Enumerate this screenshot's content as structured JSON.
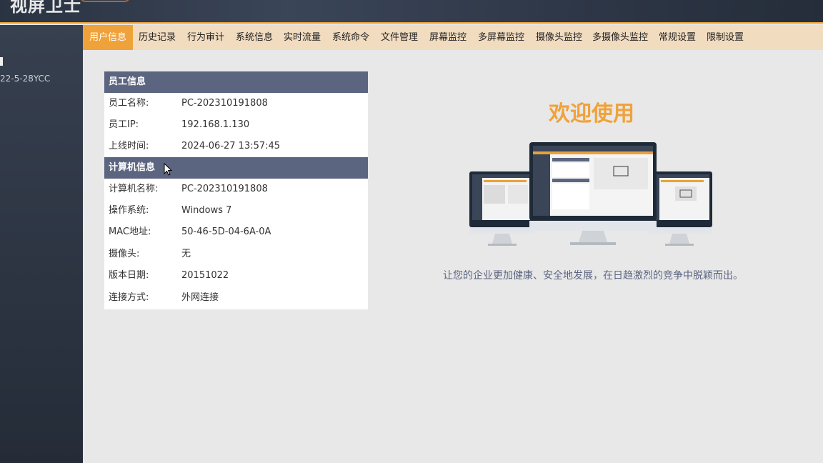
{
  "header": {
    "title": "视屏卫士"
  },
  "sidebar": {
    "version": "22-5-28YCC"
  },
  "nav": {
    "tabs": [
      {
        "label": "用户信息",
        "active": true
      },
      {
        "label": "历史记录"
      },
      {
        "label": "行为审计"
      },
      {
        "label": "系统信息"
      },
      {
        "label": "实时流量"
      },
      {
        "label": "系统命令"
      },
      {
        "label": "文件管理"
      },
      {
        "label": "屏幕监控"
      },
      {
        "label": "多屏幕监控"
      },
      {
        "label": "摄像头监控"
      },
      {
        "label": "多摄像头监控"
      },
      {
        "label": "常规设置"
      },
      {
        "label": "限制设置"
      }
    ]
  },
  "employee": {
    "section_title": "员工信息",
    "rows": [
      {
        "label": "员工名称:",
        "value": "PC-202310191808"
      },
      {
        "label": "员工IP:",
        "value": "192.168.1.130"
      },
      {
        "label": "上线时间:",
        "value": "2024-06-27 13:57:45"
      }
    ]
  },
  "computer": {
    "section_title": "计算机信息",
    "rows": [
      {
        "label": "计算机名称:",
        "value": "PC-202310191808"
      },
      {
        "label": "操作系统:",
        "value": "Windows 7"
      },
      {
        "label": "MAC地址:",
        "value": "50-46-5D-04-6A-0A"
      },
      {
        "label": "摄像头:",
        "value": "无"
      },
      {
        "label": "版本日期:",
        "value": "20151022"
      },
      {
        "label": "连接方式:",
        "value": "外网连接"
      }
    ]
  },
  "welcome": {
    "title": "欢迎使用",
    "slogan": "让您的企业更加健康、安全地发展，在日趋激烈的竞争中脱颖而出。"
  },
  "colors": {
    "accent": "#f0a23a",
    "nav_bg": "#f1dcc0",
    "section_header": "#5b6580",
    "sidebar_bg": "#2c3442"
  },
  "icons": [
    "cursor-arrow-icon",
    "monitor-illustration"
  ]
}
